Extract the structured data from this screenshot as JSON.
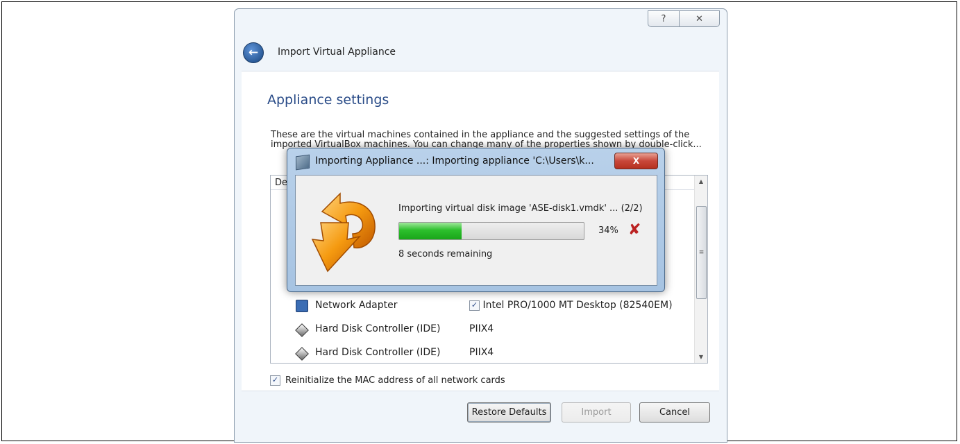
{
  "wizard": {
    "title": "Import Virtual Appliance",
    "help_glyph": "?",
    "close_glyph": "✕",
    "back_glyph": "←",
    "heading": "Appliance settings",
    "description": "These are the virtual machines contained in the appliance and the suggested settings of the imported VirtualBox machines. You can change many of the properties shown by double-click...",
    "tree": {
      "header_prefix": "De",
      "rows": [
        {
          "label": "Network Adapter",
          "value": "Intel PRO/1000 MT Desktop (82540EM)",
          "checked": true
        },
        {
          "label": "Hard Disk Controller (IDE)",
          "value": "PIIX4"
        },
        {
          "label": "Hard Disk Controller (IDE)",
          "value": "PIIX4"
        }
      ],
      "scroll_up": "▲",
      "scroll_down": "▼",
      "scroll_grip": "≡"
    },
    "mac_checkbox": {
      "label": "Reinitialize the MAC address of all network cards",
      "checked": true,
      "glyph": "✓"
    },
    "buttons": {
      "restore": "Restore Defaults",
      "import": "Import",
      "cancel": "Cancel"
    }
  },
  "progress": {
    "title": "Importing Appliance ...: Importing appliance 'C:\\Users\\k...",
    "close_glyph": "X",
    "message": "Importing virtual disk image 'ASE-disk1.vmdk' ... (2/2)",
    "percent_value": 34,
    "percent_label": "34%",
    "remaining": "8 seconds remaining",
    "cancel_glyph": "✘"
  }
}
